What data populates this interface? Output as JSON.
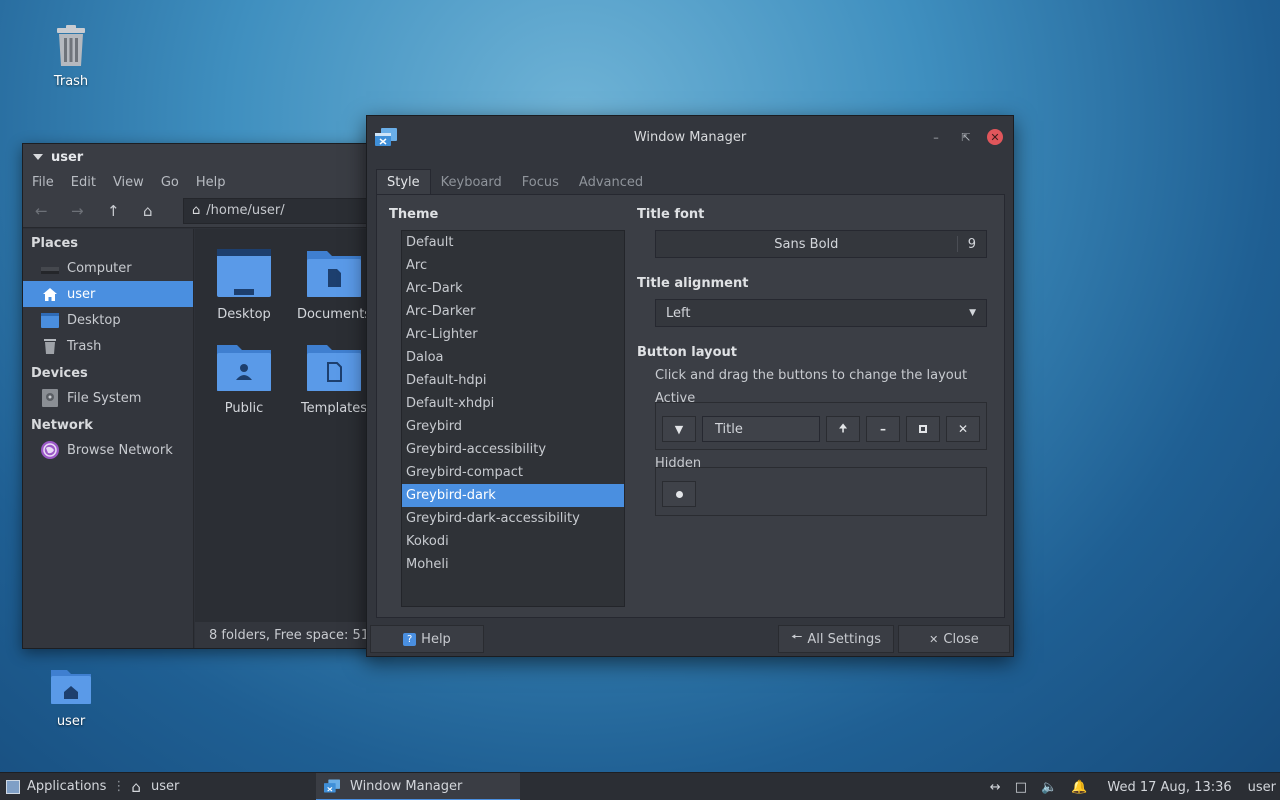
{
  "desktop": {
    "icons": [
      {
        "label": "Trash"
      },
      {
        "label": "user"
      }
    ]
  },
  "file_manager": {
    "title": "user",
    "menu": [
      "File",
      "Edit",
      "View",
      "Go",
      "Help"
    ],
    "path": "/home/user/",
    "sidebar": {
      "places_header": "Places",
      "places": [
        "Computer",
        "user",
        "Desktop",
        "Trash"
      ],
      "devices_header": "Devices",
      "devices": [
        "File System"
      ],
      "network_header": "Network",
      "network": [
        "Browse Network"
      ]
    },
    "folders": [
      "Desktop",
      "Documents",
      "Public",
      "Templates"
    ],
    "status": "8 folders, Free space: 51"
  },
  "window_manager": {
    "title": "Window Manager",
    "tabs": [
      "Style",
      "Keyboard",
      "Focus",
      "Advanced"
    ],
    "theme_label": "Theme",
    "themes": [
      "Default",
      "Arc",
      "Arc-Dark",
      "Arc-Darker",
      "Arc-Lighter",
      "Daloa",
      "Default-hdpi",
      "Default-xhdpi",
      "Greybird",
      "Greybird-accessibility",
      "Greybird-compact",
      "Greybird-dark",
      "Greybird-dark-accessibility",
      "Kokodi",
      "Moheli"
    ],
    "selected_theme": "Greybird-dark",
    "title_font_label": "Title font",
    "title_font_name": "Sans Bold",
    "title_font_size": "9",
    "title_alignment_label": "Title alignment",
    "title_alignment_value": "Left",
    "button_layout_label": "Button layout",
    "button_layout_hint": "Click and drag the buttons to change the layout",
    "active_label": "Active",
    "active_title_button": "Title",
    "hidden_label": "Hidden",
    "help_button": "Help",
    "all_settings_button": "All Settings",
    "close_button": "Close",
    "accent_color": "#4a8fe0",
    "close_color": "#e0565b"
  },
  "taskbar": {
    "applications": "Applications",
    "home_label": "user",
    "task_label": "Window Manager",
    "clock": "Wed 17 Aug, 13:36",
    "user": "user"
  }
}
